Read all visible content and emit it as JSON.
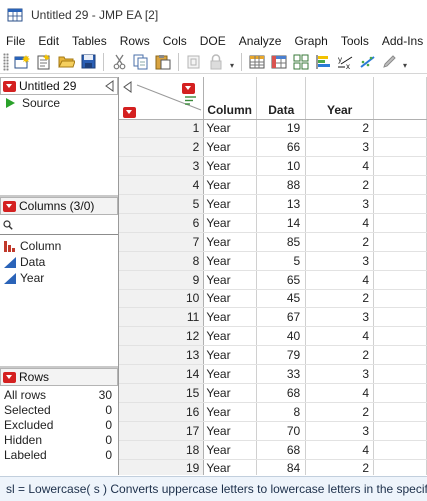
{
  "window": {
    "title": "Untitled 29 - JMP EA [2]"
  },
  "menu": [
    "File",
    "Edit",
    "Tables",
    "Rows",
    "Cols",
    "DOE",
    "Analyze",
    "Graph",
    "Tools",
    "Add-Ins"
  ],
  "table_panel": {
    "title": "Untitled 29",
    "source_label": "Source"
  },
  "columns_panel": {
    "title": "Columns (3/0)",
    "search_placeholder": "",
    "columns": [
      {
        "name": "Column",
        "type_icon": "nominal-bar-icon"
      },
      {
        "name": "Data",
        "type_icon": "continuous-triangle-icon"
      },
      {
        "name": "Year",
        "type_icon": "continuous-triangle-icon"
      }
    ]
  },
  "rows_panel": {
    "title": "Rows",
    "items": [
      {
        "label": "All rows",
        "value": "30"
      },
      {
        "label": "Selected",
        "value": "0"
      },
      {
        "label": "Excluded",
        "value": "0"
      },
      {
        "label": "Hidden",
        "value": "0"
      },
      {
        "label": "Labeled",
        "value": "0"
      }
    ]
  },
  "grid": {
    "headers": [
      "Column",
      "Data",
      "Year"
    ],
    "rows": [
      [
        "1",
        "Year",
        "19",
        "2"
      ],
      [
        "2",
        "Year",
        "66",
        "3"
      ],
      [
        "3",
        "Year",
        "10",
        "4"
      ],
      [
        "4",
        "Year",
        "88",
        "2"
      ],
      [
        "5",
        "Year",
        "13",
        "3"
      ],
      [
        "6",
        "Year",
        "14",
        "4"
      ],
      [
        "7",
        "Year",
        "85",
        "2"
      ],
      [
        "8",
        "Year",
        "5",
        "3"
      ],
      [
        "9",
        "Year",
        "65",
        "4"
      ],
      [
        "10",
        "Year",
        "45",
        "2"
      ],
      [
        "11",
        "Year",
        "67",
        "3"
      ],
      [
        "12",
        "Year",
        "40",
        "4"
      ],
      [
        "13",
        "Year",
        "79",
        "2"
      ],
      [
        "14",
        "Year",
        "33",
        "3"
      ],
      [
        "15",
        "Year",
        "68",
        "4"
      ],
      [
        "16",
        "Year",
        "8",
        "2"
      ],
      [
        "17",
        "Year",
        "70",
        "3"
      ],
      [
        "18",
        "Year",
        "68",
        "4"
      ],
      [
        "19",
        "Year",
        "84",
        "2"
      ]
    ]
  },
  "status": {
    "text": "sl = Lowercase( s )  Converts uppercase letters to lowercase letters in the specifie"
  },
  "colors": {
    "accent_red": "#d42020",
    "source_green": "#2aa12a",
    "column_blue": "#2a63b8",
    "nominal_red": "#c0392b"
  }
}
